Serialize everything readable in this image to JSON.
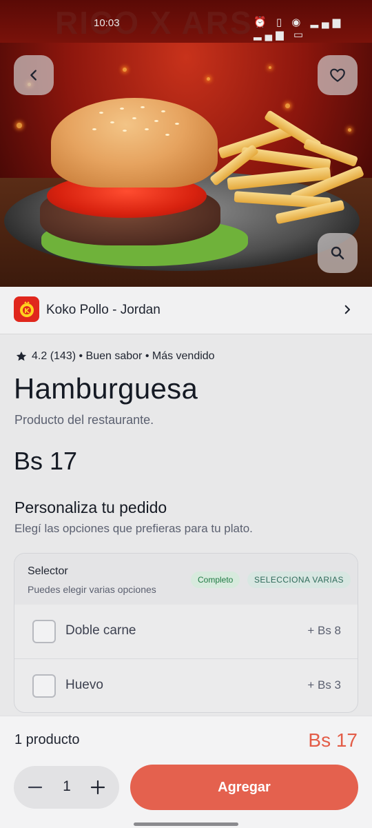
{
  "status_bar": {
    "time": "10:03",
    "icons": "⏰ ▯ ◉ ▂▄▆ ▂▄▆ ▭"
  },
  "hero": {
    "banner_text": "RICO  X  ARS",
    "back_icon": "chevron-left-icon",
    "favorite_icon": "heart-icon",
    "search_icon": "search-icon"
  },
  "store": {
    "name": "Koko Pollo - Jordan",
    "logo_letter": "K",
    "brand_color": "#e0271d"
  },
  "product": {
    "rating": "4.2 (143) • Buen sabor • Más vendido",
    "title": "Hamburguesa",
    "description": "Producto del restaurante.",
    "price": "Bs 17"
  },
  "customize": {
    "title": "Personaliza tu pedido",
    "subtitle": "Elegí las opciones que prefieras para tu plato."
  },
  "selector": {
    "title": "Selector",
    "subtitle": "Puedes elegir varias opciones",
    "badge_complete": "Completo",
    "badge_multi": "SELECCIONA VARIAS",
    "options": [
      {
        "label": "Doble carne",
        "price": "+ Bs 8",
        "checked": false
      },
      {
        "label": "Huevo",
        "price": "+ Bs 3",
        "checked": false
      }
    ]
  },
  "footer": {
    "count_label": "1 producto",
    "total": "Bs 17",
    "quantity": "1",
    "add_label": "Agregar",
    "accent_color": "#e4614e"
  }
}
